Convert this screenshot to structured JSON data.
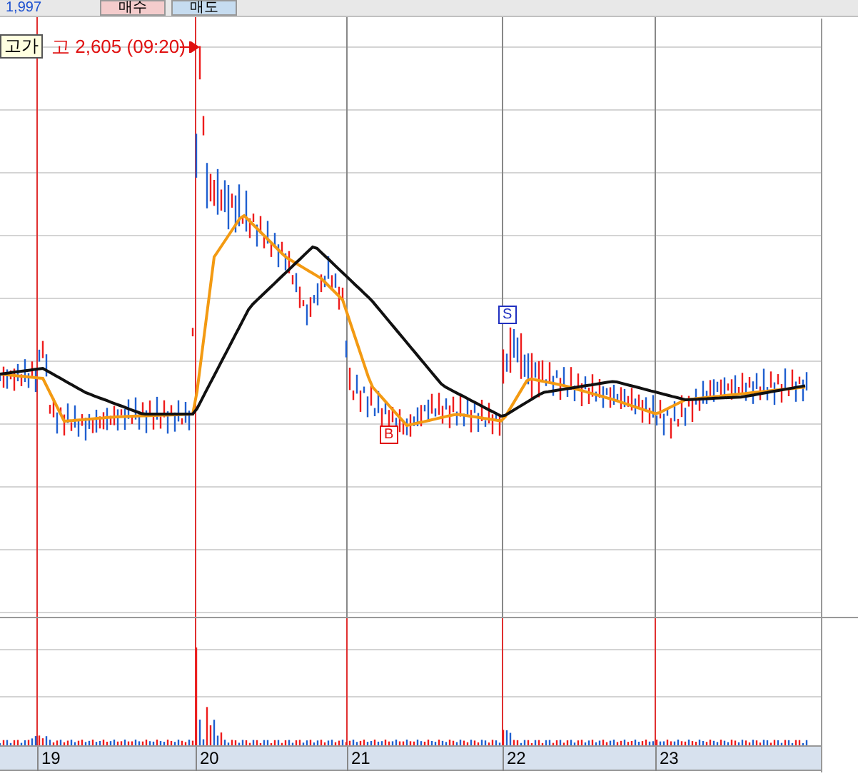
{
  "top_bar": {
    "quote": "1,997",
    "buttons": [
      {
        "label": "매수",
        "kind": "buy"
      },
      {
        "label": "매도",
        "kind": "sell"
      }
    ]
  },
  "chart": {
    "high_tag": "고가",
    "high_label": "고 2,605 (09:20)",
    "signals": [
      {
        "kind": "sell",
        "label": "S"
      },
      {
        "kind": "buy",
        "label": "B"
      }
    ],
    "dates": [
      "19",
      "20",
      "21",
      "22",
      "23"
    ]
  }
}
